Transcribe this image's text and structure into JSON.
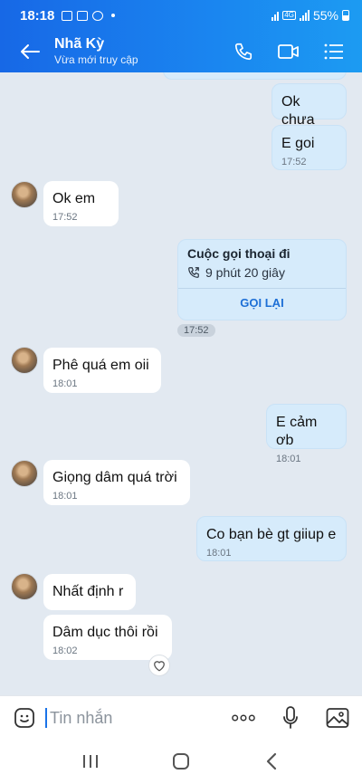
{
  "status": {
    "time": "18:18",
    "battery": "55%",
    "network": "4G"
  },
  "header": {
    "name": "Nhã Kỳ",
    "subtitle": "Vừa mới truy cập"
  },
  "messages": [
    {
      "text": "Ok chưa",
      "time": ""
    },
    {
      "text": "E goi",
      "time": "17:52"
    },
    {
      "text": "Ok em",
      "time": "17:52"
    },
    {
      "text": "Phê quá em oii",
      "time": "18:01"
    },
    {
      "text": "E cảm ơb",
      "time": "18:01"
    },
    {
      "text": "Giọng dâm quá trời",
      "time": "18:01"
    },
    {
      "text": "Co bạn bè gt giiup e",
      "time": "18:01"
    },
    {
      "text": "Nhất định r",
      "time": ""
    },
    {
      "text": "Dâm dục thôi rồi",
      "time": "18:02"
    }
  ],
  "call": {
    "title": "Cuộc gọi thoại đi",
    "duration": "9 phút 20 giây",
    "callback": "GỌI LẠI",
    "time": "17:52"
  },
  "composer": {
    "placeholder": "Tin nhắn"
  },
  "colors": {
    "header": "#1a7ef0",
    "outgoing": "#d6ebfb",
    "incoming": "#ffffff",
    "background": "#e2e9f1",
    "accent": "#1d6fd6"
  }
}
